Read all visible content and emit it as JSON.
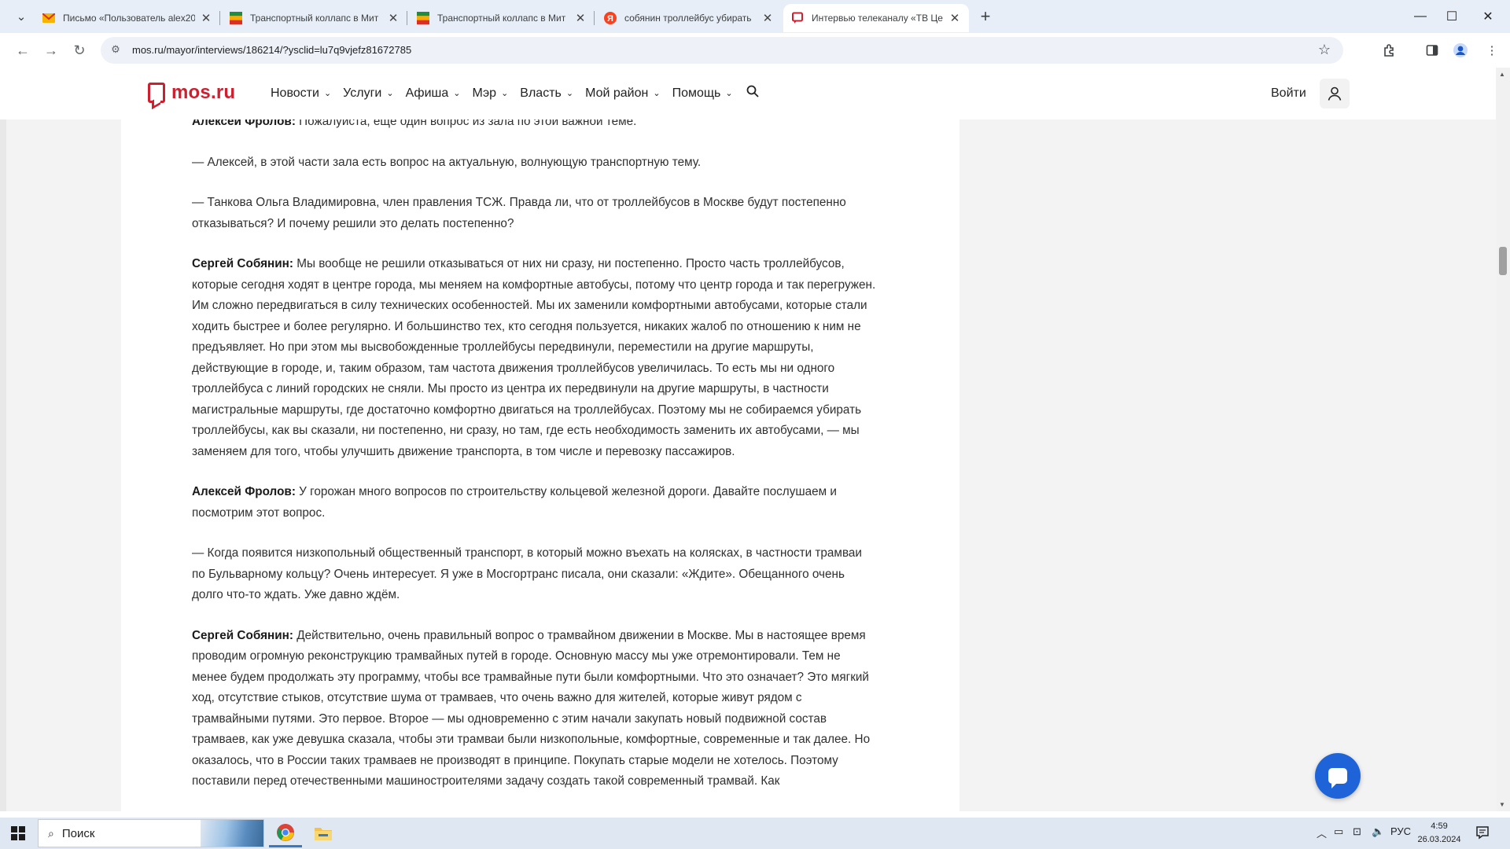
{
  "browser": {
    "tabs": [
      {
        "title": "Письмо «Пользователь alex20",
        "favicon": "mail-icon",
        "active": false
      },
      {
        "title": "Транспортный коллапс в Мит",
        "favicon": "site-flag-icon",
        "active": false
      },
      {
        "title": "Транспортный коллапс в Мит",
        "favicon": "site-flag-icon",
        "active": false
      },
      {
        "title": "собянин троллейбус убирать",
        "favicon": "yandex-icon",
        "active": false
      },
      {
        "title": "Интервью телеканалу «ТВ Це",
        "favicon": "mos-icon",
        "active": true
      }
    ],
    "url": "mos.ru/mayor/interviews/186214/?ysclid=lu7q9vjefz81672785"
  },
  "site": {
    "logo_text": "mos.ru",
    "nav": [
      "Новости",
      "Услуги",
      "Афиша",
      "Мэр",
      "Власть",
      "Мой район",
      "Помощь"
    ],
    "login_label": "Войти",
    "brand_color": "#cc1f2f"
  },
  "article": {
    "paragraphs": [
      {
        "speaker": "Алексей Фролов:",
        "text": " Пожалуйста, ещё один вопрос из зала по этой важной теме."
      },
      {
        "speaker": "",
        "text": "— Алексей, в этой части зала есть вопрос на актуальную, волнующую транспортную тему."
      },
      {
        "speaker": "",
        "text": "— Танкова Ольга Владимировна, член правления ТСЖ. Правда ли, что от троллейбусов в Москве будут постепенно отказываться? И почему решили это делать постепенно?"
      },
      {
        "speaker": "Сергей Собянин:",
        "text": " Мы вообще не решили отказываться от них ни сразу, ни постепенно. Просто часть троллейбусов, которые сегодня ходят в центре города, мы меняем на комфортные автобусы, потому что центр города и так перегружен. Им сложно передвигаться в силу технических особенностей. Мы их заменили комфортными автобусами, которые стали ходить быстрее и более регулярно. И большинство тех, кто сегодня пользуется, никаких жалоб по отношению к ним не предъявляет. Но при этом мы высвобожденные троллейбусы передвинули, переместили на другие маршруты, действующие в городе, и, таким образом, там частота движения троллейбусов увеличилась. То есть мы ни одного троллейбуса с линий городских не сняли. Мы просто из центра их передвинули на другие маршруты, в частности магистральные маршруты, где достаточно комфортно двигаться на троллейбусах. Поэтому мы не собираемся убирать троллейбусы, как вы сказали, ни постепенно, ни сразу, но там, где есть необходимость заменить их автобусами, — мы заменяем для того, чтобы улучшить движение транспорта, в том числе и перевозку пассажиров."
      },
      {
        "speaker": "Алексей Фролов:",
        "text": " У горожан много вопросов по строительству кольцевой железной дороги. Давайте послушаем и посмотрим этот вопрос."
      },
      {
        "speaker": "",
        "text": "— Когда появится низкопольный общественный транспорт, в который можно въехать на колясках, в частности трамваи по Бульварному кольцу? Очень интересует. Я уже в Мосгортранс писала, они сказали: «Ждите». Обещанного очень долго что-то ждать. Уже давно ждём."
      },
      {
        "speaker": "Сергей Собянин:",
        "text": " Действительно, очень правильный вопрос о трамвайном движении в Москве. Мы в настоящее время проводим огромную реконструкцию трамвайных путей в городе. Основную массу мы уже отремонтировали. Тем не менее будем продолжать эту программу, чтобы все трамвайные пути были комфортными. Что это означает? Это мягкий ход, отсутствие стыков, отсутствие шума от трамваев, что очень важно для жителей, которые живут рядом с трамвайными путями. Это первое. Второе — мы одновременно с этим начали закупать новый подвижной состав трамваев, как уже девушка сказала, чтобы эти трамваи были низкопольные, комфортные, современные и так далее. Но оказалось, что в России таких трамваев не производят в принципе. Покупать старые модели не хотелось. Поэтому поставили перед отечественными машиностроителями задачу создать такой современный трамвай. Как"
      }
    ]
  },
  "taskbar": {
    "search_placeholder": "Поиск",
    "language": "РУС",
    "time": "4:59",
    "date": "26.03.2024"
  }
}
